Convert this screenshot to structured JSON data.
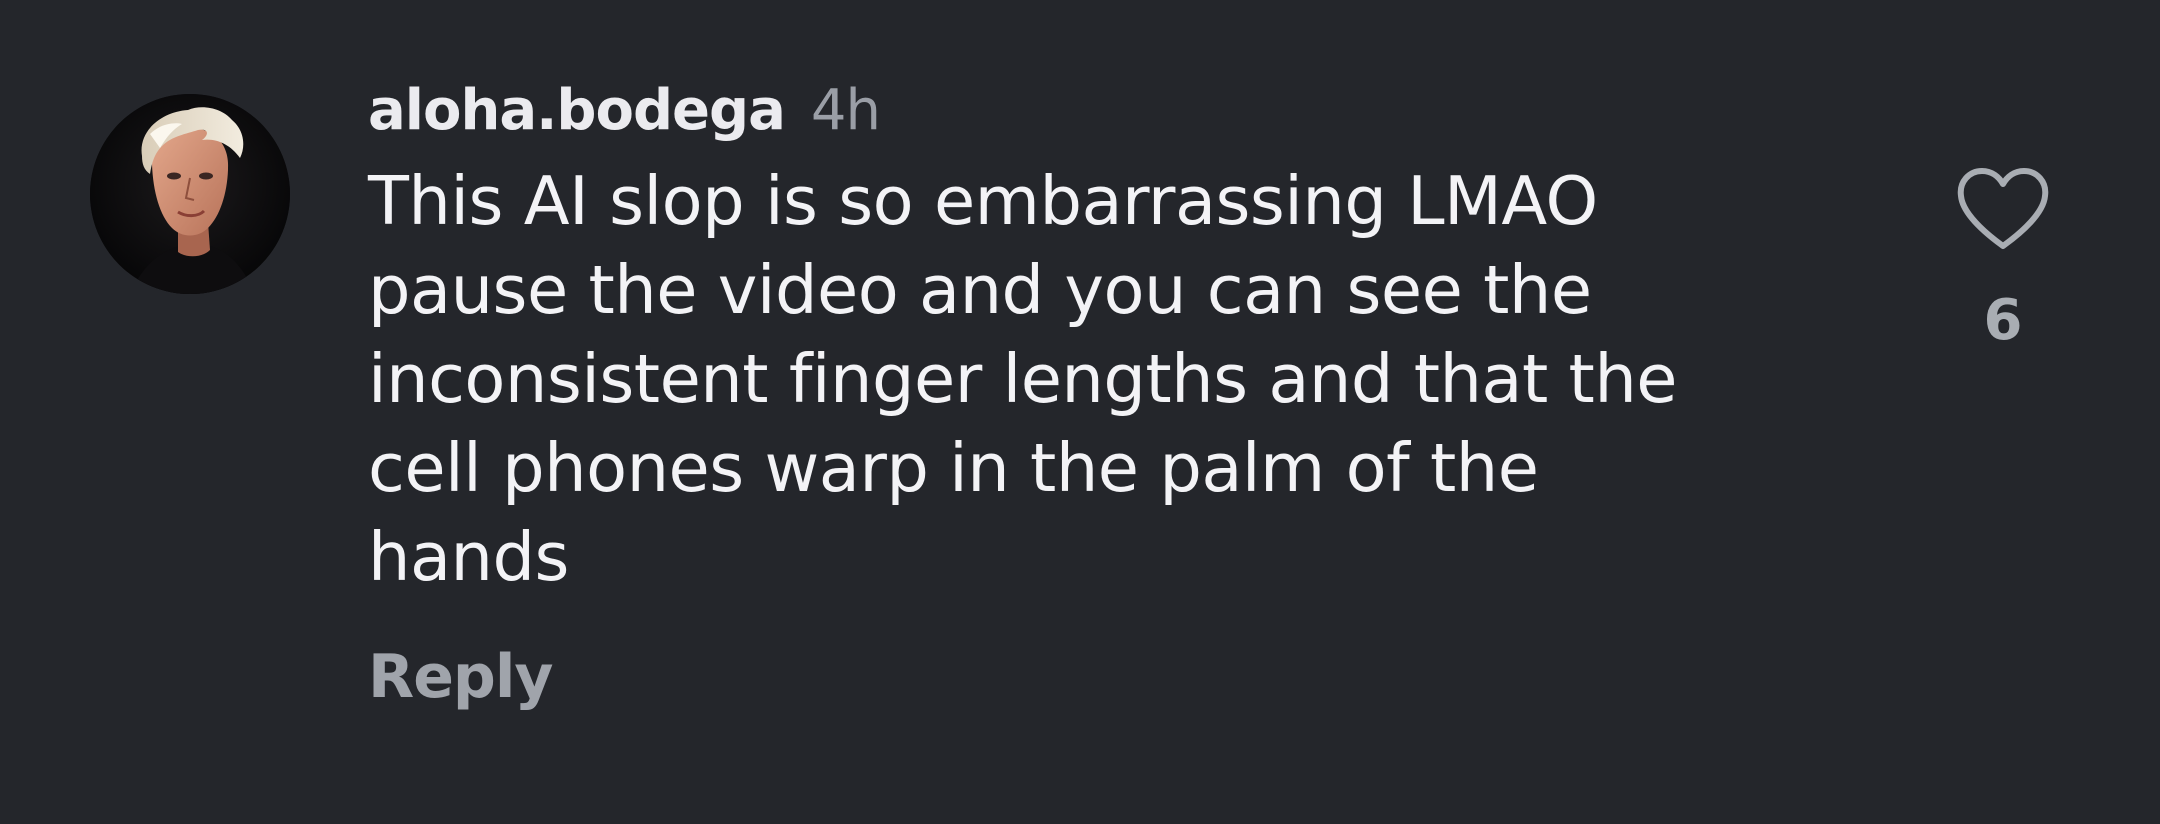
{
  "comment": {
    "username": "aloha.bodega",
    "time": "4h",
    "text_lines": [
      "This AI slop is so embarrassing LMAO",
      "pause the video and you can see the",
      "inconsistent finger lengths and that the",
      "cell phones warp in the palm of the",
      "hands"
    ],
    "reply_label": "Reply",
    "like_count": "6"
  },
  "icons": {
    "like": "heart-outline-icon",
    "avatar": "user-avatar-photo"
  },
  "colors": {
    "background": "#24262b",
    "username": "#ebebef",
    "secondary": "#9a9ea6",
    "comment_text": "#f3f3f6"
  }
}
